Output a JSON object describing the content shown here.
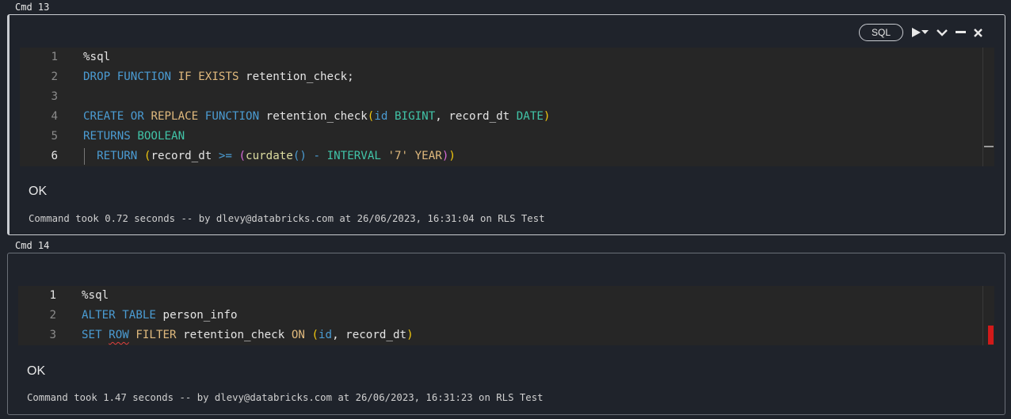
{
  "cells": [
    {
      "label": "Cmd 13",
      "language": "SQL",
      "lines": [
        {
          "n": "1",
          "tokens": [
            {
              "t": "%sql",
              "c": ""
            }
          ]
        },
        {
          "n": "2",
          "tokens": [
            {
              "t": "DROP",
              "c": "kw"
            },
            {
              "t": " ",
              "c": ""
            },
            {
              "t": "FUNCTION",
              "c": "kw"
            },
            {
              "t": " ",
              "c": ""
            },
            {
              "t": "IF",
              "c": "str"
            },
            {
              "t": " ",
              "c": ""
            },
            {
              "t": "EXISTS",
              "c": "str"
            },
            {
              "t": " retention_check;",
              "c": ""
            }
          ]
        },
        {
          "n": "3",
          "tokens": []
        },
        {
          "n": "4",
          "tokens": [
            {
              "t": "CREATE",
              "c": "kw"
            },
            {
              "t": " ",
              "c": ""
            },
            {
              "t": "OR",
              "c": "kw"
            },
            {
              "t": " ",
              "c": ""
            },
            {
              "t": "REPLACE",
              "c": "str"
            },
            {
              "t": " ",
              "c": ""
            },
            {
              "t": "FUNCTION",
              "c": "kw"
            },
            {
              "t": " retention_check",
              "c": ""
            },
            {
              "t": "(",
              "c": "p1"
            },
            {
              "t": "id",
              "c": "kw"
            },
            {
              "t": " ",
              "c": ""
            },
            {
              "t": "BIGINT",
              "c": "ty"
            },
            {
              "t": ", record_dt ",
              "c": ""
            },
            {
              "t": "DATE",
              "c": "ty"
            },
            {
              "t": ")",
              "c": "p1"
            }
          ]
        },
        {
          "n": "5",
          "tokens": [
            {
              "t": "RETURNS",
              "c": "kw"
            },
            {
              "t": " ",
              "c": ""
            },
            {
              "t": "BOOLEAN",
              "c": "ty"
            }
          ]
        },
        {
          "n": "6",
          "current": true,
          "guide": true,
          "tokens": [
            {
              "t": "  RETURN",
              "c": "kw"
            },
            {
              "t": " ",
              "c": ""
            },
            {
              "t": "(",
              "c": "p1"
            },
            {
              "t": "record_dt ",
              "c": ""
            },
            {
              "t": ">=",
              "c": "kw"
            },
            {
              "t": " ",
              "c": ""
            },
            {
              "t": "(",
              "c": "p2"
            },
            {
              "t": "curdate",
              "c": "fn"
            },
            {
              "t": "()",
              "c": "p3"
            },
            {
              "t": " ",
              "c": ""
            },
            {
              "t": "-",
              "c": "kw"
            },
            {
              "t": " ",
              "c": ""
            },
            {
              "t": "INTERVAL",
              "c": "ty"
            },
            {
              "t": " ",
              "c": ""
            },
            {
              "t": "'7'",
              "c": "str"
            },
            {
              "t": " ",
              "c": ""
            },
            {
              "t": "YEAR",
              "c": "str"
            },
            {
              "t": ")",
              "c": "p2"
            },
            {
              "t": ")",
              "c": "p1"
            }
          ]
        }
      ],
      "result": "OK",
      "meta": "Command took 0.72 seconds -- by dlevy@databricks.com at 26/06/2023, 16:31:04 on RLS Test"
    },
    {
      "label": "Cmd 14",
      "lines": [
        {
          "n": "1",
          "current": true,
          "tokens": [
            {
              "t": "%sql",
              "c": ""
            }
          ]
        },
        {
          "n": "2",
          "tokens": [
            {
              "t": "ALTER",
              "c": "kw"
            },
            {
              "t": " ",
              "c": ""
            },
            {
              "t": "TABLE",
              "c": "kw"
            },
            {
              "t": " person_info",
              "c": ""
            }
          ]
        },
        {
          "n": "3",
          "tokens": [
            {
              "t": "SET",
              "c": "kw"
            },
            {
              "t": " ",
              "c": ""
            },
            {
              "t": "ROW",
              "c": "kw",
              "squiggle": true
            },
            {
              "t": " ",
              "c": ""
            },
            {
              "t": "FILTER",
              "c": "str"
            },
            {
              "t": " retention_check ",
              "c": ""
            },
            {
              "t": "ON",
              "c": "str"
            },
            {
              "t": " ",
              "c": ""
            },
            {
              "t": "(",
              "c": "p1"
            },
            {
              "t": "id",
              "c": "kw"
            },
            {
              "t": ", record_dt",
              "c": ""
            },
            {
              "t": ")",
              "c": "p1"
            }
          ]
        }
      ],
      "result": "OK",
      "meta": "Command took 1.47 seconds -- by dlevy@databricks.com at 26/06/2023, 16:31:23 on RLS Test"
    }
  ],
  "icons": {
    "run": "play-icon",
    "run_caret": "caret-down-icon",
    "collapse": "chevron-down-icon",
    "minimize": "minus-icon",
    "close": "close-icon"
  },
  "colors": {
    "background": "#1f232b",
    "editor": "#262626",
    "keyword": "#4b9cd3",
    "type": "#41c4a8",
    "string": "#e0b97d",
    "error": "#d11a1a"
  }
}
